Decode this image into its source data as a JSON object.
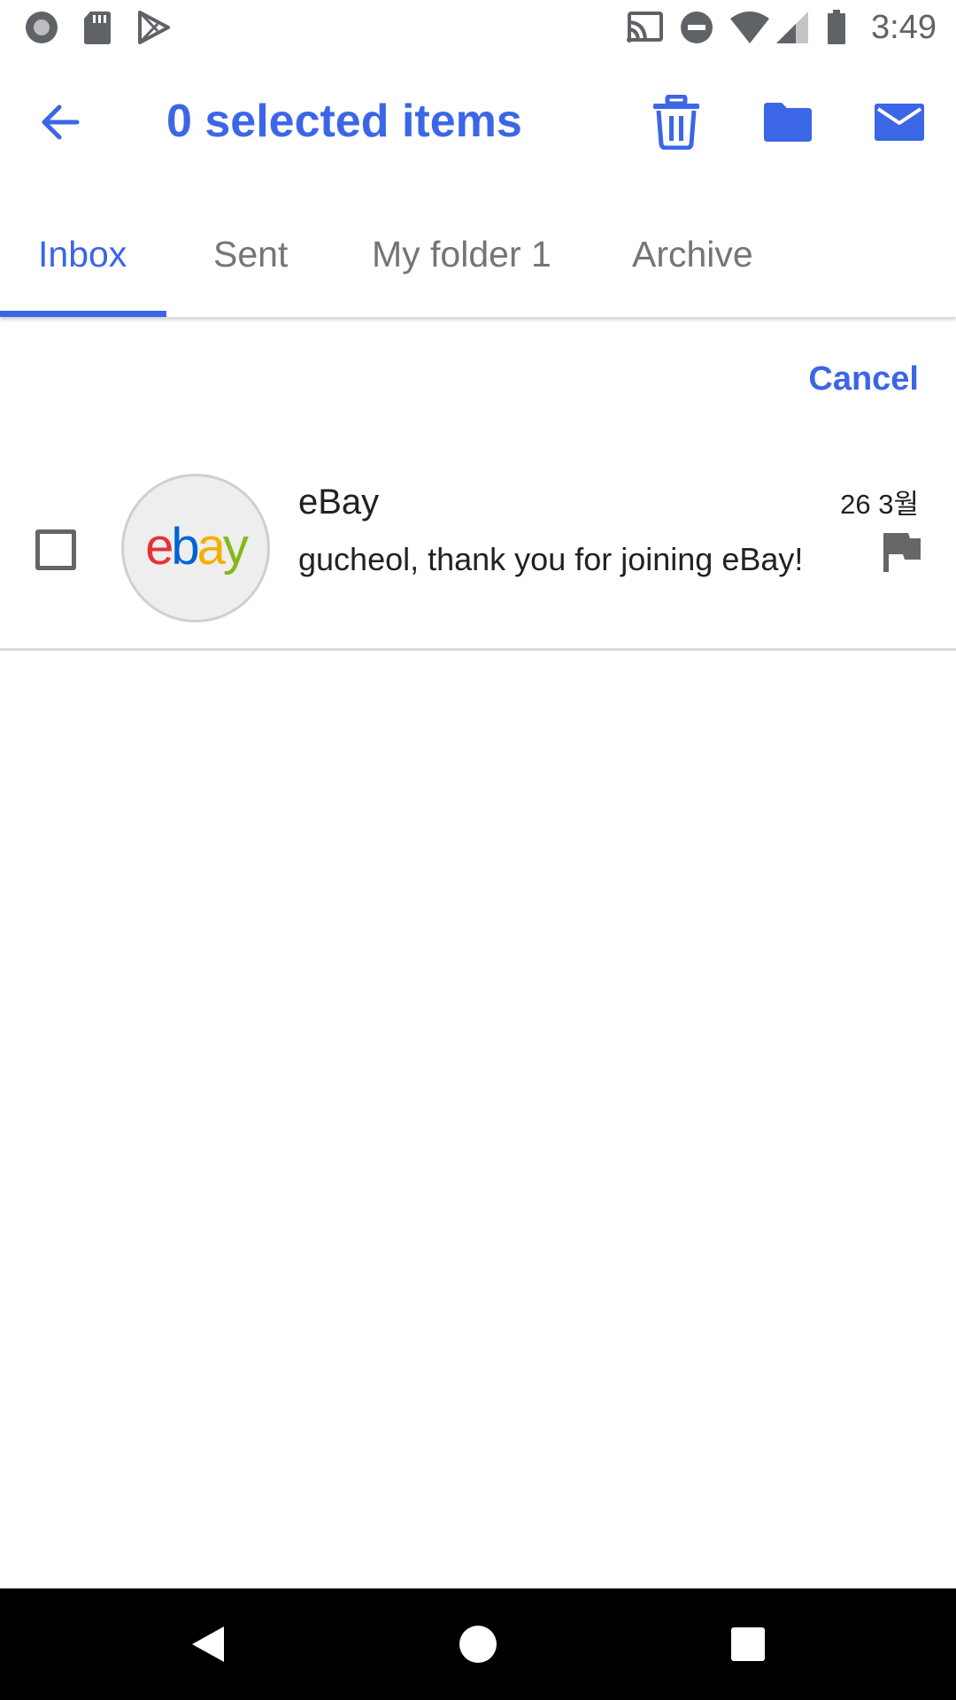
{
  "status_bar": {
    "time": "3:49",
    "left_icons": [
      "record-icon",
      "sd-card-icon",
      "play-store-icon"
    ],
    "right_icons": [
      "cast-icon",
      "do-not-disturb-icon",
      "wifi-icon",
      "signal-icon",
      "battery-icon"
    ]
  },
  "app_bar": {
    "title": "0 selected items",
    "actions": [
      "delete-icon",
      "folder-icon",
      "mail-icon"
    ]
  },
  "tabs": [
    {
      "label": "Inbox",
      "active": true
    },
    {
      "label": "Sent",
      "active": false
    },
    {
      "label": "My folder 1",
      "active": false
    },
    {
      "label": "Archive",
      "active": false
    }
  ],
  "cancel_label": "Cancel",
  "messages": [
    {
      "sender": "eBay",
      "preview": "gucheol, thank you for joining eBay!",
      "date": "26 3월",
      "checked": false,
      "flagged": true,
      "avatar_logo": "ebay"
    }
  ],
  "colors": {
    "accent": "#3b66e6",
    "tab_inactive": "#757575",
    "text": "#212121"
  }
}
